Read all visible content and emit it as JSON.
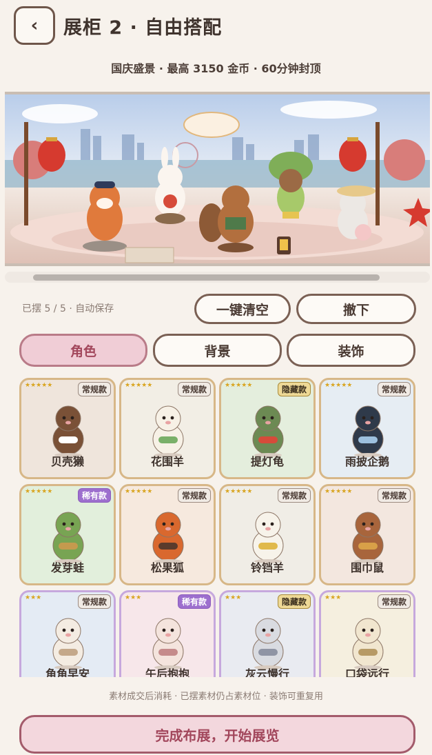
{
  "header": {
    "back_icon": "chevron-left-icon",
    "back_glyph": "‹",
    "title": "展柜 2 · 自由搭配"
  },
  "subtitle": "国庆盛景 · 最高 3150 金币 · 60分钟封顶",
  "status": "已摆 5 / 5 · 自动保存",
  "actions": {
    "clear_label": "一键清空",
    "remove_label": "撤下"
  },
  "tabs": [
    {
      "label": "角色",
      "active": true
    },
    {
      "label": "背景",
      "active": false
    },
    {
      "label": "装饰",
      "active": false
    }
  ],
  "items": [
    {
      "name": "贝壳獭",
      "badge": "常规款",
      "badge_type": "regular",
      "stars": "★★★★★",
      "bg": "#efe5dc",
      "border": "gold",
      "color": "#7a5137",
      "accent": "#ffffff"
    },
    {
      "name": "花围羊",
      "badge": "常规款",
      "badge_type": "regular",
      "stars": "★★★★★",
      "bg": "#f2eee5",
      "border": "gold",
      "color": "#f7f1e6",
      "accent": "#7ab069"
    },
    {
      "name": "提灯龟",
      "badge": "隐藏款",
      "badge_type": "hidden",
      "stars": "★★★★★",
      "bg": "#e4eedd",
      "border": "gold",
      "color": "#6c8a53",
      "accent": "#d64b3a"
    },
    {
      "name": "雨披企鹅",
      "badge": "常规款",
      "badge_type": "regular",
      "stars": "★★★★★",
      "bg": "#e6edf3",
      "border": "gold",
      "color": "#2f3a4a",
      "accent": "#9dc0de"
    },
    {
      "name": "发芽蛙",
      "badge": "稀有款",
      "badge_type": "rare",
      "stars": "★★★★★",
      "bg": "#e2efdc",
      "border": "gold",
      "color": "#78a453",
      "accent": "#c49a4e"
    },
    {
      "name": "松果狐",
      "badge": "常规款",
      "badge_type": "regular",
      "stars": "★★★★★",
      "bg": "#f6e9de",
      "border": "gold",
      "color": "#d9682e",
      "accent": "#5a3b2c"
    },
    {
      "name": "铃铛羊",
      "badge": "常规款",
      "badge_type": "regular",
      "stars": "★★★★★",
      "bg": "#f0ede6",
      "border": "gold",
      "color": "#f7f3ea",
      "accent": "#e0b94b"
    },
    {
      "name": "围巾鼠",
      "badge": "常规款",
      "badge_type": "regular",
      "stars": "★★★★★",
      "bg": "#f3e7df",
      "border": "gold",
      "color": "#a8653c",
      "accent": "#d8a048"
    },
    {
      "name": "角角早安",
      "badge": "常规款",
      "badge_type": "regular",
      "stars": "★★★",
      "bg": "#e4ebf4",
      "border": "purple",
      "color": "#f4ece2",
      "accent": "#c4a88a"
    },
    {
      "name": "午后抱抱",
      "badge": "稀有款",
      "badge_type": "rare",
      "stars": "★★★",
      "bg": "#f7e7ea",
      "border": "purple",
      "color": "#f4e4dd",
      "accent": "#c58b8b"
    },
    {
      "name": "灰云慢行",
      "badge": "隐藏款",
      "badge_type": "hidden",
      "stars": "★★★",
      "bg": "#e9ebf1",
      "border": "purple",
      "color": "#d9dbe1",
      "accent": "#8f94a4"
    },
    {
      "name": "口袋远行",
      "badge": "常规款",
      "badge_type": "regular",
      "stars": "★★★",
      "bg": "#f5efdf",
      "border": "purple",
      "color": "#f1e6cf",
      "accent": "#b79a66"
    }
  ],
  "footnote": "素材成交后消耗 · 已摆素材仍占素材位 · 装饰可重复用",
  "cta_label": "完成布展，开始展览"
}
